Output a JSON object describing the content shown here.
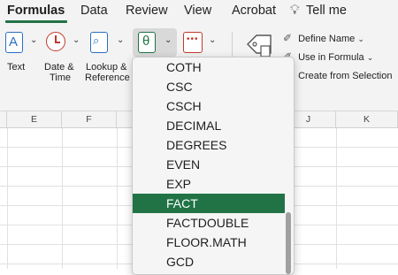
{
  "ribbon_tabs": [
    "Formulas",
    "Data",
    "Review",
    "View",
    "Acrobat",
    "Tell me"
  ],
  "ribbon": {
    "text_label": "Text",
    "datetime_label": [
      "Date &",
      "Time"
    ],
    "lookup_label": [
      "Lookup &",
      "Reference"
    ],
    "define_name": "Define Name",
    "use_in_formula": "Use in Formula",
    "create_from_selection": "Create from Selection",
    "caret": "⌄"
  },
  "columns": [
    "E",
    "F",
    "J",
    "K"
  ],
  "dropdown": {
    "items": [
      "COTH",
      "CSC",
      "CSCH",
      "DECIMAL",
      "DEGREES",
      "EVEN",
      "EXP",
      "FACT",
      "FACTDOUBLE",
      "FLOOR.MATH",
      "GCD"
    ],
    "selected": "FACT"
  },
  "colors": {
    "accent": "#217346",
    "text_icon": "#2b6fbf",
    "datetime_icon": "#c0392b",
    "lookup_icon": "#2b6fbf",
    "more_icon": "#c0392b"
  }
}
